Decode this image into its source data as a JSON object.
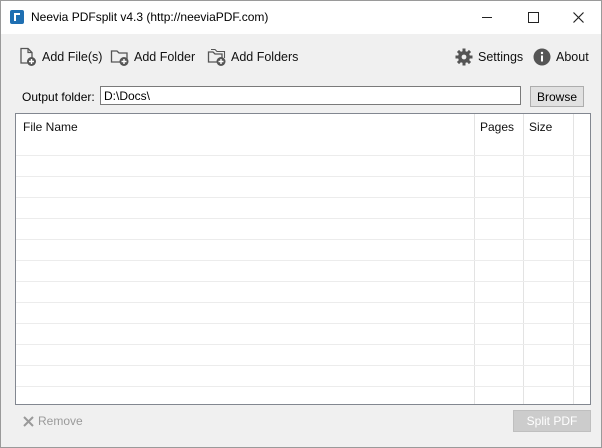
{
  "window": {
    "title": "Neevia PDFsplit v4.3 (http://neeviaPDF.com)"
  },
  "toolbar": {
    "add_files": "Add File(s)",
    "add_folder": "Add Folder",
    "add_folders": "Add Folders",
    "settings": "Settings",
    "about": "About"
  },
  "output": {
    "label": "Output folder:",
    "value": "D:\\Docs\\",
    "browse": "Browse"
  },
  "file_list": {
    "columns": [
      "File Name",
      "Pages",
      "Size"
    ],
    "rows": []
  },
  "footer": {
    "remove": "Remove",
    "split": "Split PDF"
  },
  "colors": {
    "app_icon": "#1f6fb2",
    "disabled_text": "#9a9a9a",
    "disabled_button": "#cccccc"
  }
}
